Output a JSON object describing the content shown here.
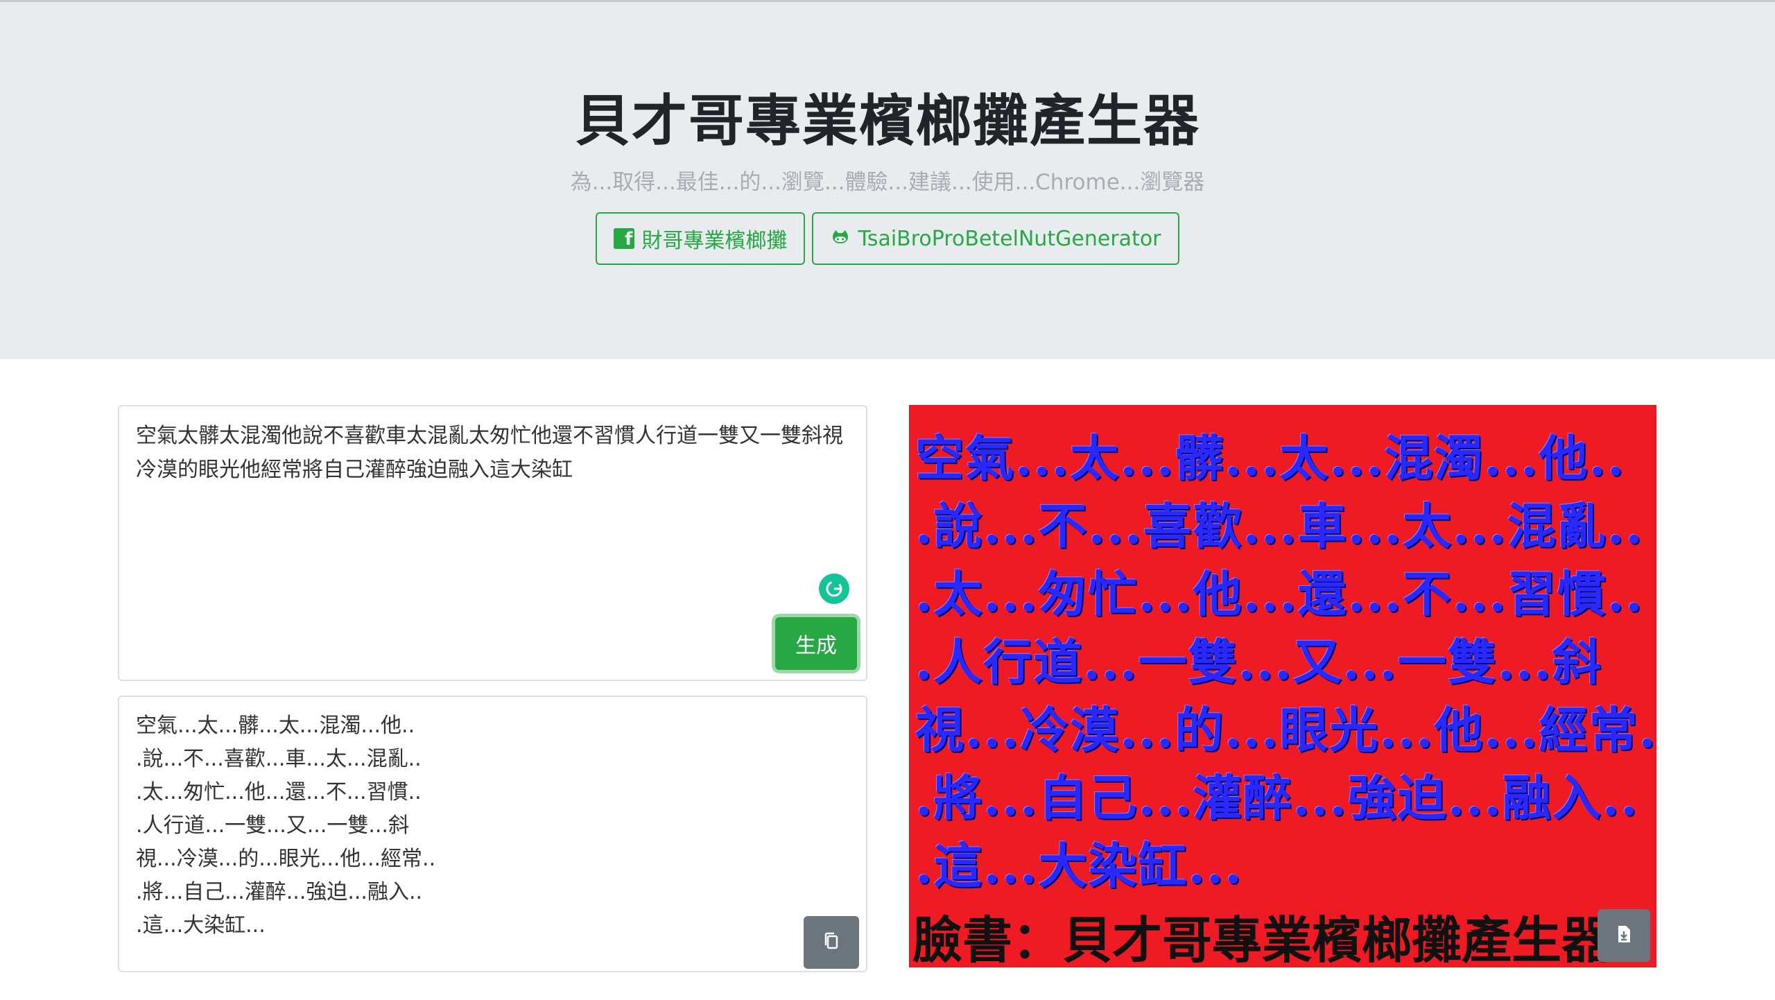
{
  "header": {
    "title": "貝才哥專業檳榔攤產生器",
    "subtitle": "為...取得...最佳...的...瀏覽...體驗...建議...使用...Chrome...瀏覽器",
    "facebook_button": "財哥專業檳榔攤",
    "github_button": "TsaiBroProBetelNutGenerator"
  },
  "input": {
    "text": "空氣太髒太混濁他說不喜歡車太混亂太匆忙他還不習慣人行道一雙又一雙斜視冷漠的眼光他經常將自己灌醉強迫融入這大染缸",
    "generate_label": "生成"
  },
  "output": {
    "lines": [
      "空氣...太...髒...太...混濁...他..",
      ".說...不...喜歡...車...太...混亂..",
      ".太...匆忙...他...還...不...習慣..",
      ".人行道...一雙...又...一雙...斜",
      "視...冷漠...的...眼光...他...經常..",
      ".將...自己...灌醉...強迫...融入..",
      ".這...大染缸..."
    ]
  },
  "image": {
    "lines": [
      "空氣...太...髒...太...混濁...他..",
      ".說...不...喜歡...車...太...混亂..",
      ".太...匆忙...他...還...不...習慣..",
      ".人行道...一雙...又...一雙...斜",
      "視...冷漠...的...眼光...他...經常..",
      ".將...自己...灌醉...強迫...融入..",
      ".這...大染缸..."
    ],
    "footer": "臉書：貝才哥專業檳榔攤產生器",
    "background_color": "#ee1b24",
    "text_color": "#2828ff"
  },
  "colors": {
    "accent": "#28a745",
    "secondary": "#6c757d"
  }
}
